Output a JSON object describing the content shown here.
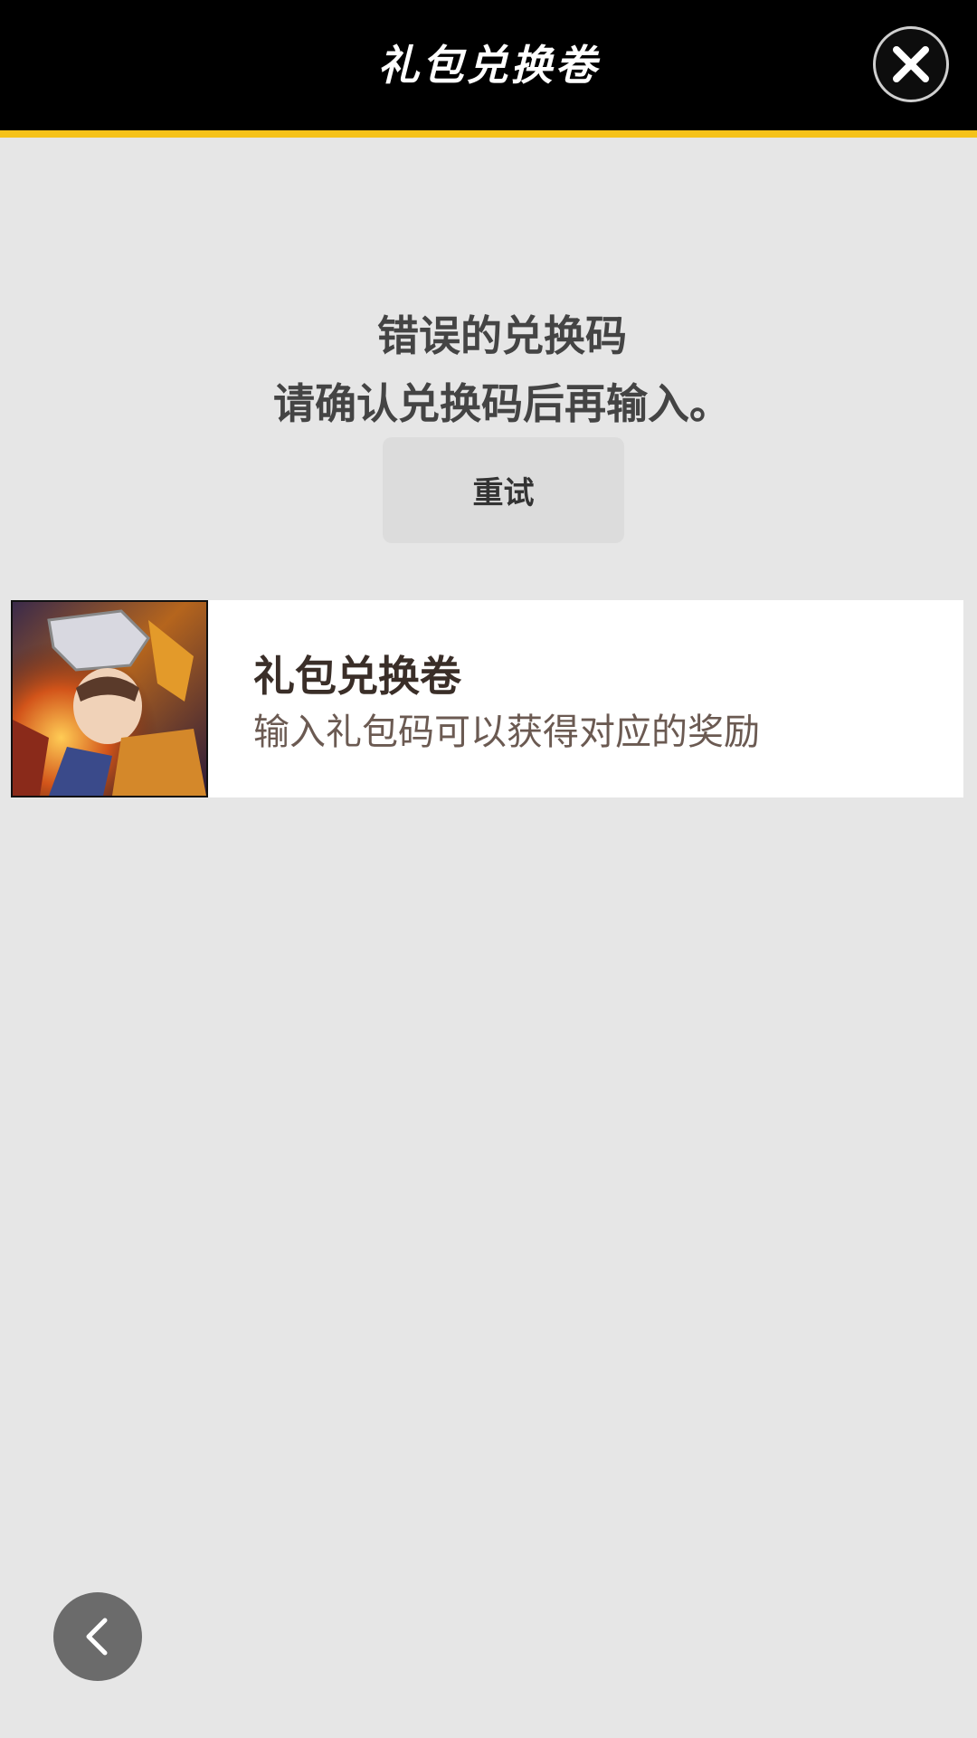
{
  "header": {
    "title": "礼包兑换卷",
    "close_icon": "close-icon",
    "accent_color": "#f5c21a"
  },
  "message": {
    "line1": "错误的兑换码",
    "line2": "请确认兑换码后再输入。",
    "retry_label": "重试"
  },
  "card": {
    "title": "礼包兑换卷",
    "description": "输入礼包码可以获得对应的奖励",
    "thumbnail_icon": "hero-portrait"
  },
  "back_icon": "chevron-left-icon"
}
